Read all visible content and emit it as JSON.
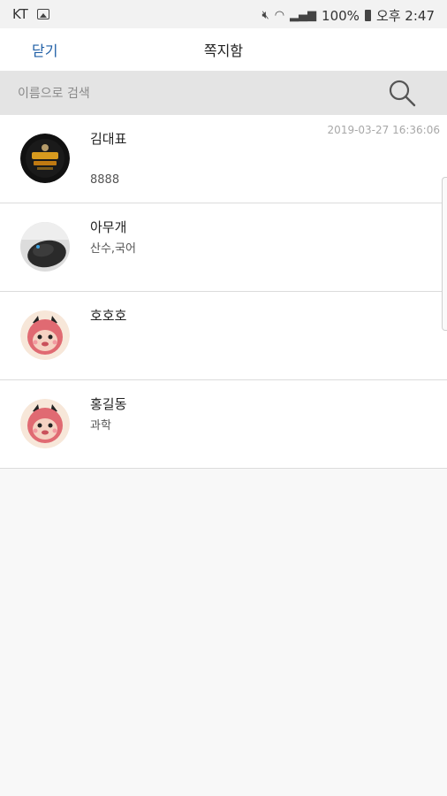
{
  "status_bar": {
    "carrier": "KT",
    "battery": "100%",
    "time": "오후 2:47"
  },
  "header": {
    "close_label": "닫기",
    "title": "쪽지함"
  },
  "search": {
    "placeholder": "이름으로 검색"
  },
  "messages": [
    {
      "name": "김대표",
      "subtitle": "",
      "message": "8888",
      "time": "2019-03-27 16:36:06",
      "avatar": "academy-logo-avatar"
    },
    {
      "name": "아무개",
      "subtitle": "산수,국어",
      "message": "",
      "time": "",
      "avatar": "mouse-photo-avatar"
    },
    {
      "name": "호호호",
      "subtitle": "",
      "message": "",
      "time": "",
      "avatar": "pink-monkey-avatar"
    },
    {
      "name": "홍길동",
      "subtitle": "과학",
      "message": "",
      "time": "",
      "avatar": "pink-monkey-avatar"
    }
  ],
  "colors": {
    "accent": "#1f5fa6",
    "search_bg": "#e4e4e4",
    "page_bg": "#f8f8f8"
  }
}
